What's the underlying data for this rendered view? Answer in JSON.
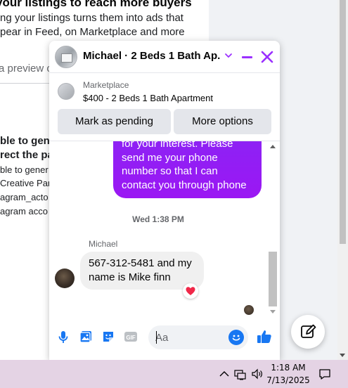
{
  "background": {
    "lines": [
      "your listings to reach more buyers",
      "ng your listings turns them into ads that",
      "pear in Feed, on Marketplace and more",
      "a preview o",
      "ble to gen",
      "rect the pa",
      "ble to gener",
      "Creative Par",
      "agram_acto",
      "agram acco"
    ]
  },
  "chat": {
    "title": "Michael · 2 Beds 1 Bath Ap...",
    "listing": {
      "label": "Marketplace",
      "title": "$400 - 2 Beds 1 Bath Apartment"
    },
    "buttons": {
      "mark_pending": "Mark as pending",
      "more_options": "More options"
    },
    "messages": {
      "sent": "for your interest. Please send me your phone number so that I can contact you through phone",
      "timestamp": "Wed 1:38 PM",
      "sender_name": "Michael",
      "received": "567-312-5481 and my name is Mike finn",
      "reaction": "heart"
    },
    "composer": {
      "placeholder": "Aa"
    },
    "colors": {
      "accent": "#8a24f5",
      "messenger_blue": "#1877f2"
    }
  },
  "taskbar": {
    "time": "1:18 AM",
    "date": "7/13/2025"
  }
}
